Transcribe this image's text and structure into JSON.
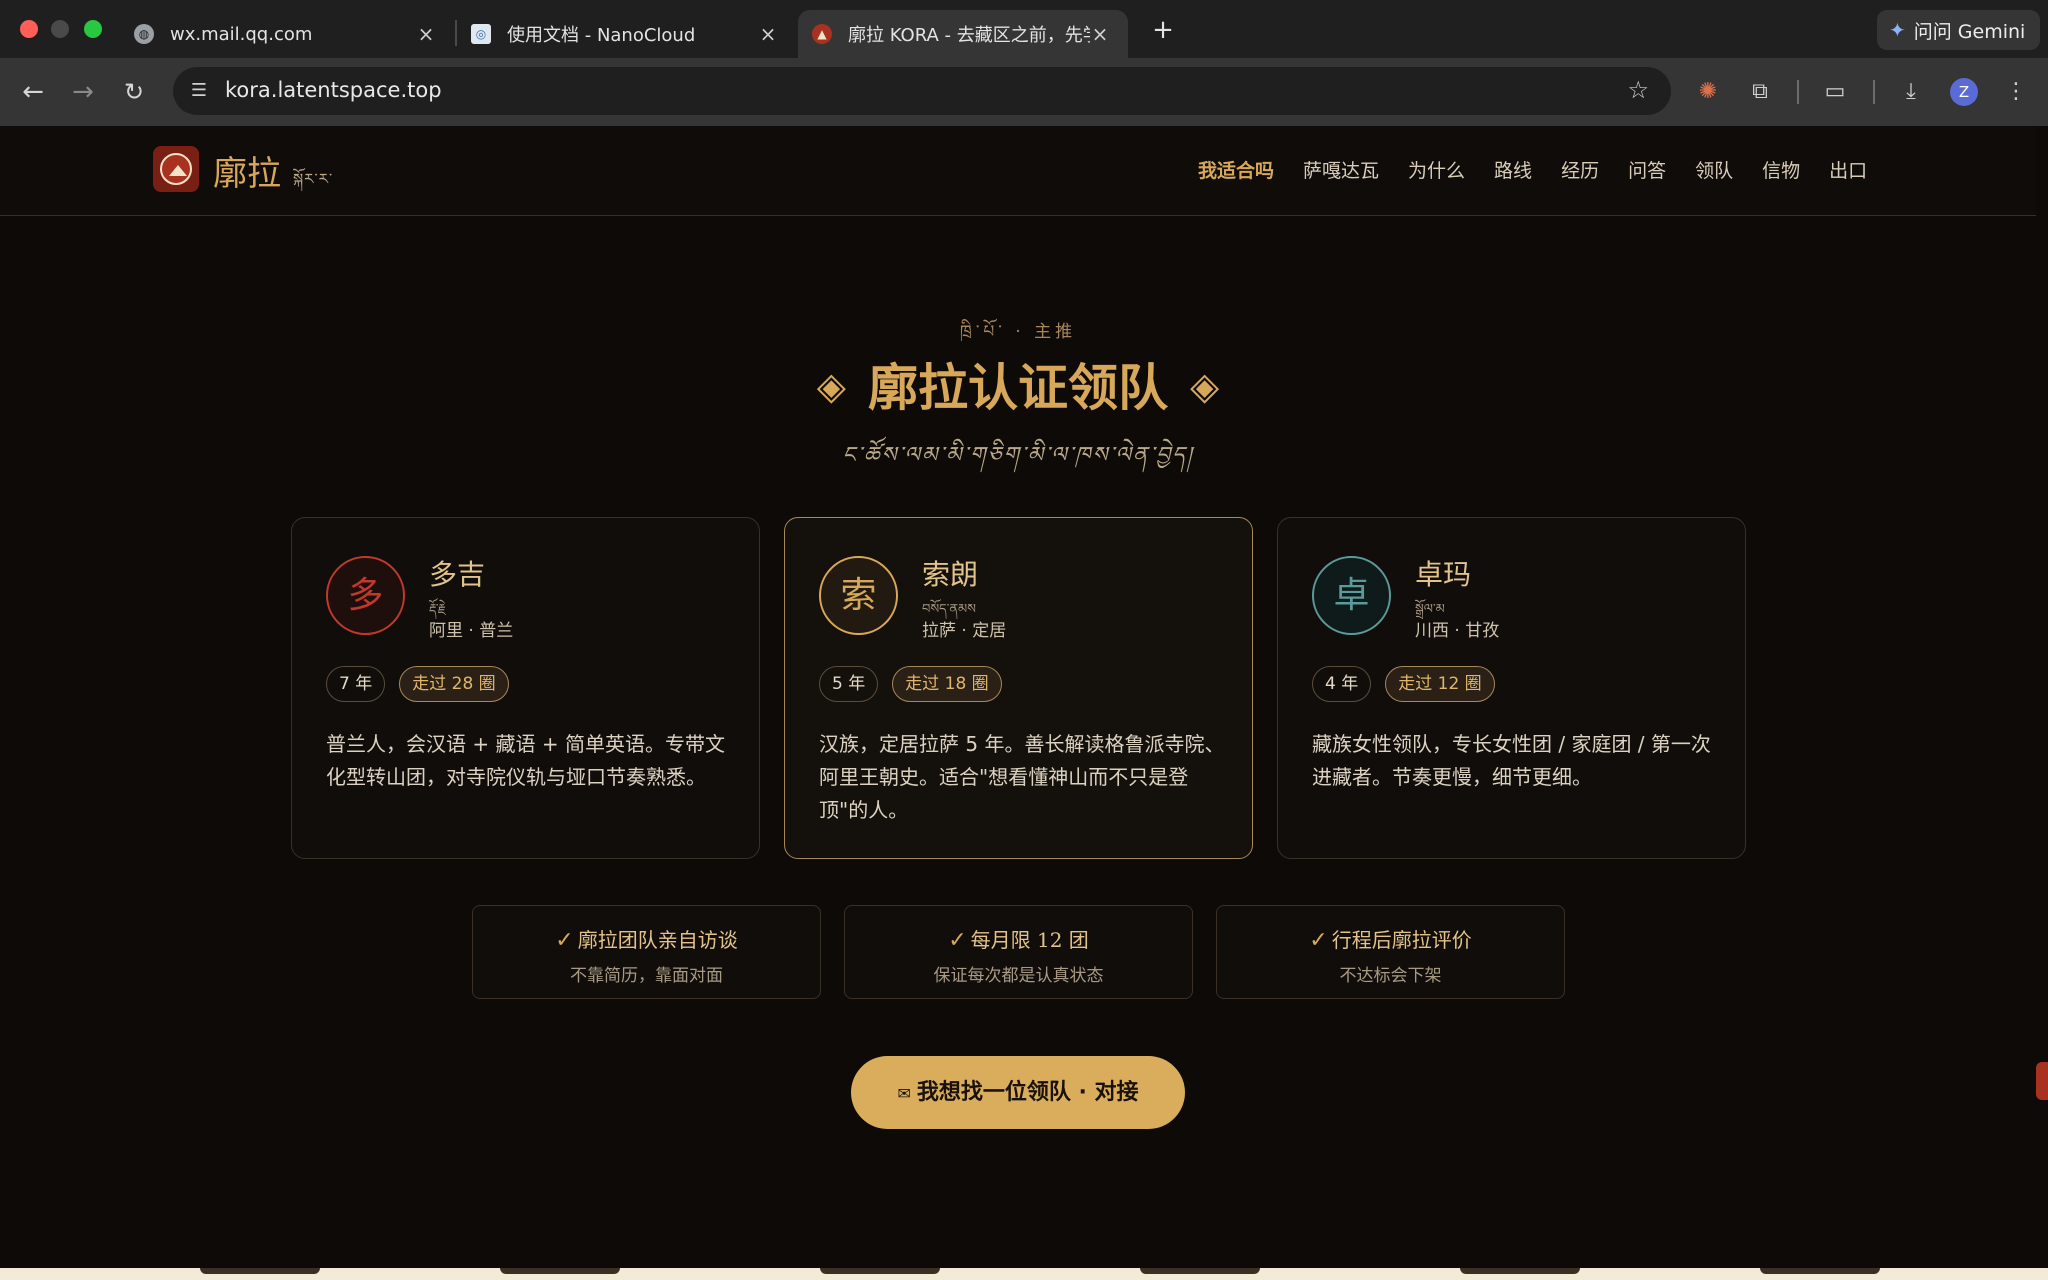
{
  "browser": {
    "tabs": [
      {
        "title": "wx.mail.qq.com",
        "favicon": "globe-icon"
      },
      {
        "title": "使用文档 - NanoCloud",
        "favicon": "nanocloud-icon"
      },
      {
        "title": "廓拉 KORA - 去藏区之前，先学",
        "favicon": "kora-icon"
      }
    ],
    "new_tab": "+",
    "gemini_label": "问问 Gemini",
    "url": "kora.latentspace.top",
    "avatar_letter": "Z"
  },
  "site": {
    "brand": "廓拉",
    "brand_tibetan": "སྐོར་ར་",
    "nav": [
      {
        "label": "我适合吗",
        "active": true
      },
      {
        "label": "萨嘎达瓦"
      },
      {
        "label": "为什么"
      },
      {
        "label": "路线"
      },
      {
        "label": "经历"
      },
      {
        "label": "问答"
      },
      {
        "label": "领队"
      },
      {
        "label": "信物"
      },
      {
        "label": "出口"
      }
    ]
  },
  "section": {
    "eyebrow": "ཁྲི་པོ་ · 主推",
    "title": "廓拉认证领队",
    "diamond": "◈",
    "subtitle": "ང་ཚོས་ལམ་མི་གཅིག་མི་ལ་ཁས་ལེན་བྱེད།"
  },
  "guides": [
    {
      "badge": "多",
      "name": "多吉",
      "tibetan": "རྡོ་རྗེ",
      "origin": "阿里 · 普兰",
      "years": "7 年",
      "rounds": "走过 28 圈",
      "desc": "普兰人，会汉语 + 藏语 + 简单英语。专带文化型转山团，对寺院仪轨与垭口节奏熟悉。",
      "color": "#c0392b"
    },
    {
      "badge": "索",
      "name": "索朗",
      "tibetan": "བསོད་ནམས",
      "origin": "拉萨 · 定居",
      "years": "5 年",
      "rounds": "走过 18 圈",
      "desc": "汉族，定居拉萨 5 年。善长解读格鲁派寺院、阿里王朝史。适合\"想看懂神山而不只是登顶\"的人。",
      "color": "#d8a85a"
    },
    {
      "badge": "卓",
      "name": "卓玛",
      "tibetan": "སྒྲོལ་མ",
      "origin": "川西 · 甘孜",
      "years": "4 年",
      "rounds": "走过 12 圈",
      "desc": "藏族女性领队，专长女性团 / 家庭团 / 第一次进藏者。节奏更慢，细节更细。",
      "color": "#5a9a9a"
    }
  ],
  "promises": [
    {
      "check": "✓",
      "title": "廓拉团队亲自访谈",
      "sub": "不靠简历，靠面对面"
    },
    {
      "check": "✓",
      "title": "每月限 12 团",
      "sub": "保证每次都是认真状态"
    },
    {
      "check": "✓",
      "title": "行程后廓拉评价",
      "sub": "不达标会下架"
    }
  ],
  "cta": {
    "icon": "✉",
    "label": "我想找一位领队 · 对接"
  }
}
